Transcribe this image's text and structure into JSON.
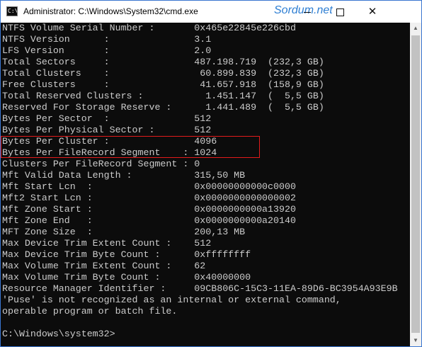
{
  "titlebar": {
    "icon_text": "C:\\_",
    "title": "Administrator: C:\\Windows\\System32\\cmd.exe",
    "watermark": "Sordum.net",
    "minimize_symbol": "",
    "maximize_symbol": "",
    "close_symbol": "✕"
  },
  "console": {
    "lines": [
      "NTFS Volume Serial Number :       0x465e22845e226cbd",
      "NTFS Version      :               3.1",
      "LFS Version       :               2.0",
      "Total Sectors     :               487.198.719  (232,3 GB)",
      "Total Clusters    :                60.899.839  (232,3 GB)",
      "Free Clusters     :                41.657.918  (158,9 GB)",
      "Total Reserved Clusters :           1.451.147  (  5,5 GB)",
      "Reserved For Storage Reserve :      1.441.489  (  5,5 GB)",
      "Bytes Per Sector  :               512",
      "Bytes Per Physical Sector :       512",
      "Bytes Per Cluster :               4096",
      "Bytes Per FileRecord Segment    : 1024",
      "Clusters Per FileRecord Segment : 0",
      "Mft Valid Data Length :           315,50 MB",
      "Mft Start Lcn  :                  0x00000000000c0000",
      "Mft2 Start Lcn :                  0x0000000000000002",
      "Mft Zone Start :                  0x0000000000a13920",
      "Mft Zone End   :                  0x0000000000a20140",
      "MFT Zone Size  :                  200,13 MB",
      "Max Device Trim Extent Count :    512",
      "Max Device Trim Byte Count :      0xffffffff",
      "Max Volume Trim Extent Count :    62",
      "Max Volume Trim Byte Count :      0x40000000",
      "Resource Manager Identifier :     09CB806C-15C3-11EA-89D6-BC3954A93E9B",
      "'Puse' is not recognized as an internal or external command,",
      "operable program or batch file.",
      "",
      "C:\\Windows\\system32>"
    ]
  },
  "scrollbar": {
    "up_symbol": "▲",
    "down_symbol": "▼"
  },
  "colors": {
    "highlight": "#e21b1b",
    "console_bg": "#0c0c0c",
    "console_text": "#cccccc",
    "watermark": "#2f7fd3"
  }
}
